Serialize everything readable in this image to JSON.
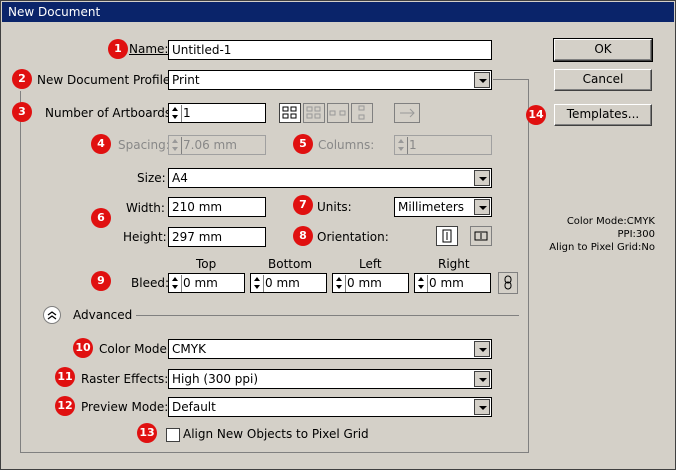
{
  "window": {
    "title": "New Document"
  },
  "badges": [
    "1",
    "2",
    "3",
    "4",
    "5",
    "6",
    "7",
    "8",
    "9",
    "10",
    "11",
    "12",
    "13",
    "14"
  ],
  "form": {
    "name_label": "Name:",
    "name_value": "Untitled-1",
    "profile_label": "New Document Profile:",
    "profile_value": "Print",
    "artboards_label": "Number of Artboards:",
    "artboards_value": "1",
    "spacing_label": "Spacing:",
    "spacing_value": "7.06 mm",
    "columns_label": "Columns:",
    "columns_value": "1",
    "size_label": "Size:",
    "size_value": "A4",
    "width_label": "Width:",
    "width_value": "210 mm",
    "height_label": "Height:",
    "height_value": "297 mm",
    "units_label": "Units:",
    "units_value": "Millimeters",
    "orientation_label": "Orientation:",
    "bleed_label": "Bleed:",
    "bleed": {
      "top_label": "Top",
      "top_value": "0 mm",
      "bottom_label": "Bottom",
      "bottom_value": "0 mm",
      "left_label": "Left",
      "left_value": "0 mm",
      "right_label": "Right",
      "right_value": "0 mm"
    },
    "advanced_label": "Advanced",
    "color_mode_label": "Color Mode:",
    "color_mode_value": "CMYK",
    "raster_label": "Raster Effects:",
    "raster_value": "High (300 ppi)",
    "preview_label": "Preview Mode:",
    "preview_value": "Default",
    "align_label": "Align New Objects to Pixel Grid",
    "align_checked": false
  },
  "buttons": {
    "ok": "OK",
    "cancel": "Cancel",
    "templates": "Templates..."
  },
  "info": {
    "color_mode": "Color Mode:CMYK",
    "ppi": "PPI:300",
    "align": "Align to Pixel Grid:No"
  },
  "colors": {
    "titlebar": "#0a246a",
    "badge": "#e01010",
    "dialog": "#d4d0c8"
  }
}
